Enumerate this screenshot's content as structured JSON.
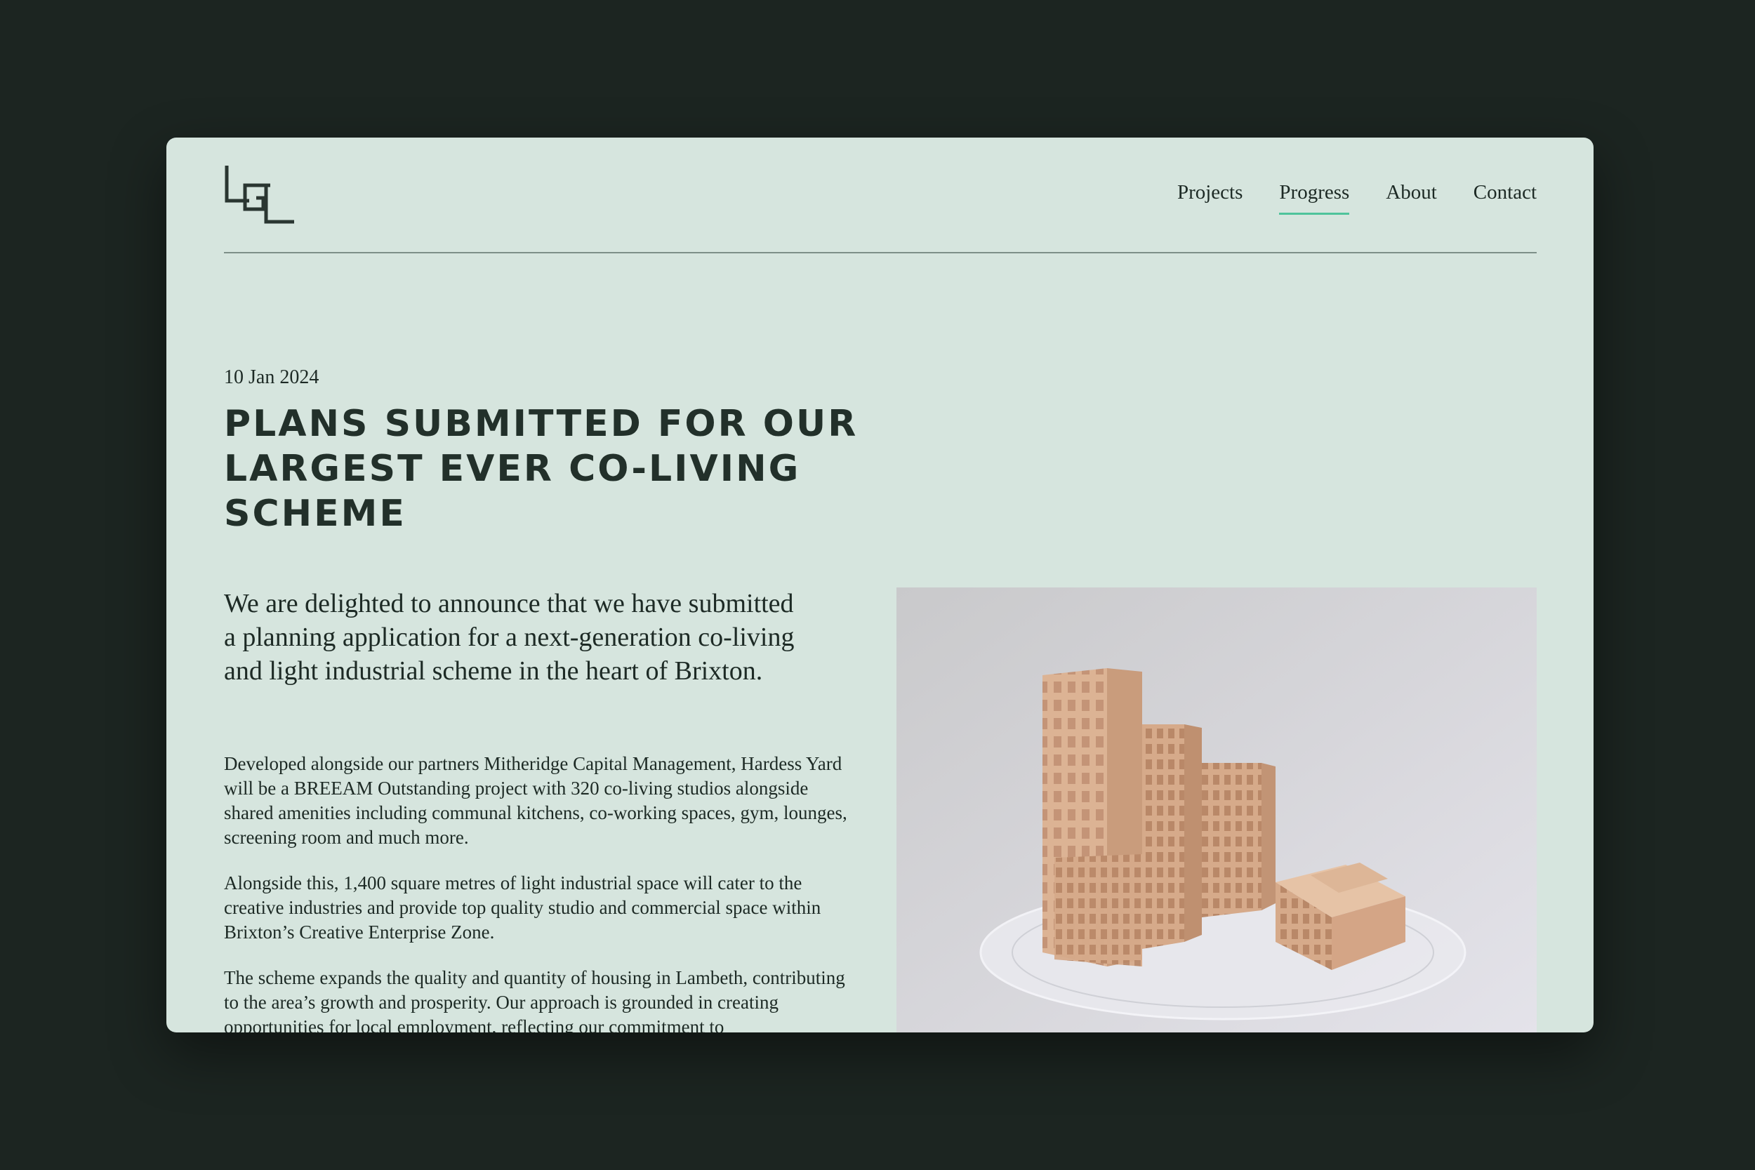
{
  "header": {
    "logo_text": "LGL",
    "nav": [
      {
        "label": "Projects",
        "active": false
      },
      {
        "label": "Progress",
        "active": true
      },
      {
        "label": "About",
        "active": false
      },
      {
        "label": "Contact",
        "active": false
      }
    ]
  },
  "article": {
    "date": "10 Jan 2024",
    "title": "PLANS SUBMITTED FOR OUR LARGEST EVER CO-LIVING SCHEME",
    "lead": "We are delighted to announce that we have submitted a planning application for a next-generation co-living and light industrial scheme in the heart of Brixton.",
    "paragraphs": [
      "Developed alongside our partners Mitheridge Capital Management, Hardess Yard will be a BREEAM Outstanding project with 320 co-living studios alongside shared amenities including communal kitchens, co-working spaces, gym, lounges, screening room and much more.",
      "Alongside this, 1,400 square metres of light industrial space will cater to the creative industries and provide top quality studio and commercial space within Brixton’s Creative Enterprise Zone.",
      "The scheme expands the quality and quantity of housing in Lambeth, contributing to the area’s growth and prosperity. Our approach is grounded in creating opportunities for local employment, reflecting our commitment to"
    ],
    "image": {
      "subject": "architectural-model-photo"
    }
  },
  "colors": {
    "page_bg": "#1c2521",
    "window_bg": "#d6e5de",
    "text": "#1d2a25",
    "accent": "#4fc49b"
  }
}
